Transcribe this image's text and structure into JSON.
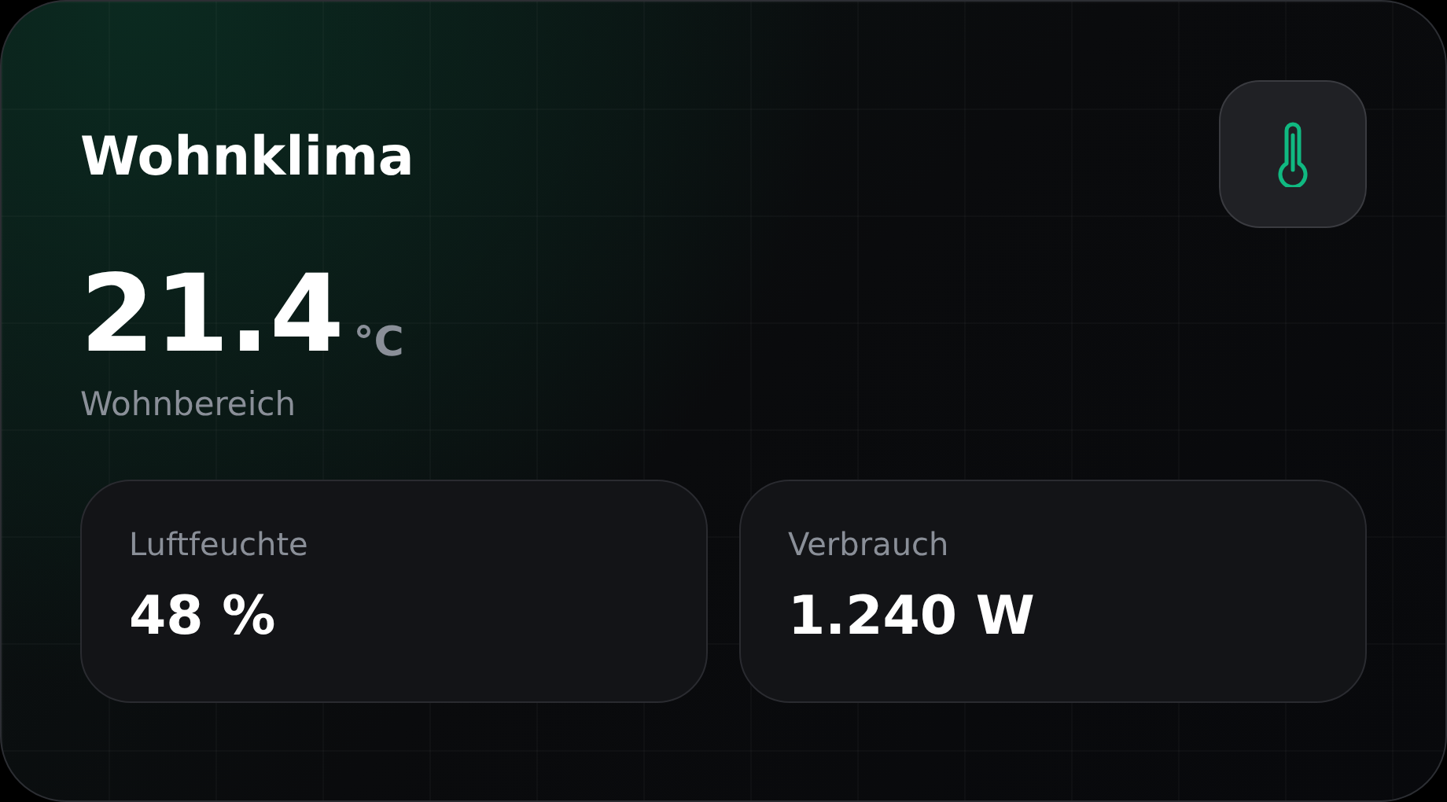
{
  "card": {
    "title": "Wohnklima",
    "temperature": "21.4",
    "unit": "°C",
    "location": "Wohnbereich"
  },
  "stats": [
    {
      "label": "Luftfeuchte",
      "value": "48 %"
    },
    {
      "label": "Verbrauch",
      "value": "1.240 W"
    }
  ]
}
